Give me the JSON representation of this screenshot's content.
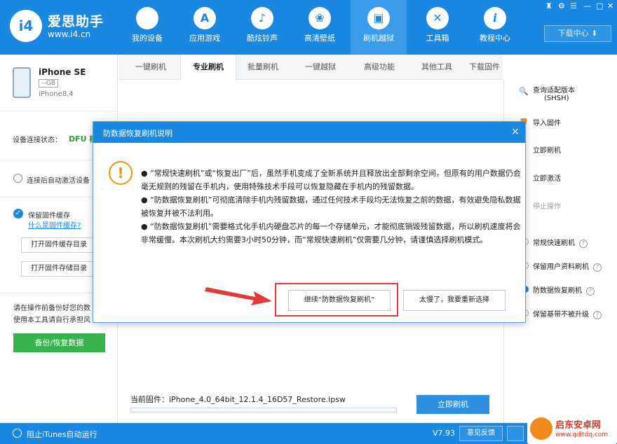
{
  "app": {
    "brand_name": "爱思助手",
    "brand_url": "www.i4.cn",
    "logo_text": "i4",
    "download_center": "下载中心 ⬇"
  },
  "nav": [
    {
      "label": "我的设备",
      "icon": "apple-icon",
      "glyph": ""
    },
    {
      "label": "应用游戏",
      "icon": "app-store-icon",
      "glyph": "A"
    },
    {
      "label": "酷炫铃声",
      "icon": "bell-icon",
      "glyph": "♪"
    },
    {
      "label": "高清壁纸",
      "icon": "flower-icon",
      "glyph": "❀"
    },
    {
      "label": "刷机越狱",
      "icon": "box-icon",
      "glyph": "▣"
    },
    {
      "label": "工具箱",
      "icon": "tools-icon",
      "glyph": "✕"
    },
    {
      "label": "教程中心",
      "icon": "info-icon",
      "glyph": "i"
    }
  ],
  "device": {
    "name": "iPhone SE",
    "storage": "--GB",
    "model": "iPhone8,4",
    "conn_label": "设备连接状态：",
    "conn_value": "DFU 模"
  },
  "left": {
    "auto_activate": "连接后自动激活设备",
    "keep_cache": "保留固件缓存",
    "what_is_cache": "什么是固件缓存?",
    "open_cache_dir": "打开固件缓存目录",
    "open_storage_dir": "打开固件存储目录",
    "backup_note_1": "请在操作前备份好您的数",
    "backup_note_2": "使用本工具请自行承担风",
    "backup_button": "备份/恢复数据"
  },
  "tabs": [
    "一键刷机",
    "专业刷机",
    "批量刷机",
    "一键越狱",
    "高级功能",
    "其他工具",
    "下载固件"
  ],
  "active_tab": "专业刷机",
  "right": {
    "shsh_line1": "查询适配版本",
    "shsh_line2": "(SHSH)",
    "import_fw": "导入固件",
    "flash_now": "立即刷机",
    "activate_now": "立即激活",
    "stop": "停止操作",
    "mode_normal": "常规快速刷机",
    "mode_keep_data": "保留用户资料刷机",
    "mode_anti_recover": "防数据恢复刷机",
    "mode_keep_baseband": "保留基带不被升级"
  },
  "main": {
    "current_fw_label": "当前固件：",
    "current_fw_value": "iPhone_4.0_64bit_12.1.4_16D57_Restore.ipsw",
    "flash_button": "立即刷机"
  },
  "modal": {
    "title": "防数据恢复刷机说明",
    "close": "×",
    "paragraph1": "●  “常规快速刷机”或“恢复出厂”后，虽然手机变成了全新系统并且释放出全部剩余空间，但原有的用户数据仍会毫无规则的残留在手机内，使用特殊技术手段可以恢复隐藏在手机内的残留数据。",
    "paragraph2": "●  “防数据恢复刷机”可彻底清除手机内残留数据，通过任何技术手段均无法恢复之前的数据，有效避免隐私数据被恢复并被不法利用。",
    "paragraph3": "●  “防数据恢复刷机”需要格式化手机内硬盘芯片的每一个存储单元，才能彻底销毁残留数据，所以刷机速度将会非常缓慢。本次刷机大约需要3小时50分钟，而“常规快速刷机”仅需要几分钟，请谨慎选择刷机模式。",
    "continue_button": "继续“防数据恢复刷机”",
    "reselect_button": "太慢了，我要重新选择"
  },
  "bottom": {
    "block_itunes": "阻止iTunes自动运行",
    "version": "V7.93",
    "feedback": "意见反馈"
  },
  "watermark": {
    "title": "启东安卓网",
    "url": "www.qdltdq.com"
  },
  "colors": {
    "primary_blue": "#1a87e0",
    "green": "#36b34a",
    "warning_orange": "#f29018",
    "highlight_red": "#e23a3a"
  }
}
